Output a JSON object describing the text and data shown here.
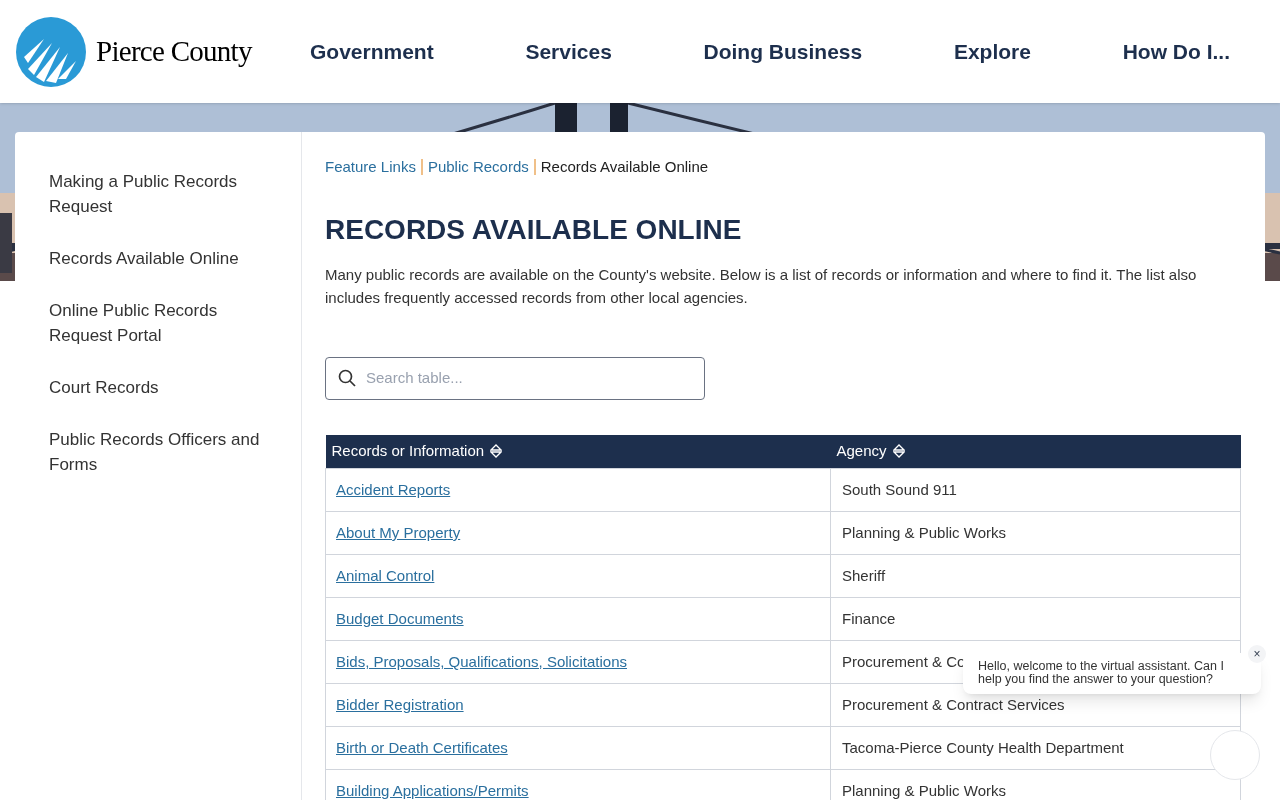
{
  "logo": {
    "name": "Pierce County"
  },
  "nav": [
    "Government",
    "Services",
    "Doing Business",
    "Explore",
    "How Do I..."
  ],
  "sidebar": {
    "items": [
      {
        "label": "Making a Public Records Request"
      },
      {
        "label": "Records Available Online"
      },
      {
        "label": "Online Public Records Request Portal"
      },
      {
        "label": "Court Records"
      },
      {
        "label": "Public Records Officers and Forms"
      }
    ]
  },
  "breadcrumb": [
    {
      "label": "Feature Links",
      "link": true
    },
    {
      "label": "Public Records",
      "link": true
    },
    {
      "label": "Records Available Online",
      "link": false
    }
  ],
  "title": "RECORDS AVAILABLE ONLINE",
  "intro": "Many public records are available on the County's website. Below is a list of records or information and where to find it. The list also includes frequently accessed records from other local agencies.",
  "search": {
    "placeholder": "Search table..."
  },
  "table": {
    "columns": [
      "Records or Information",
      "Agency"
    ],
    "rows": [
      [
        "Accident Reports",
        "South Sound 911"
      ],
      [
        "About My Property",
        "Planning & Public Works"
      ],
      [
        "Animal Control",
        "Sheriff"
      ],
      [
        "Budget Documents",
        "Finance"
      ],
      [
        "Bids, Proposals, Qualifications, Solicitations",
        "Procurement & Co"
      ],
      [
        "Bidder Registration",
        "Procurement & Contract Services"
      ],
      [
        "Birth or Death Certificates",
        "Tacoma-Pierce County Health Department"
      ],
      [
        "Building Applications/Permits",
        "Planning & Public Works"
      ]
    ]
  },
  "chat": {
    "message": "Hello, welcome to the virtual assistant. Can I help you find the answer to your question?",
    "close": "×"
  }
}
